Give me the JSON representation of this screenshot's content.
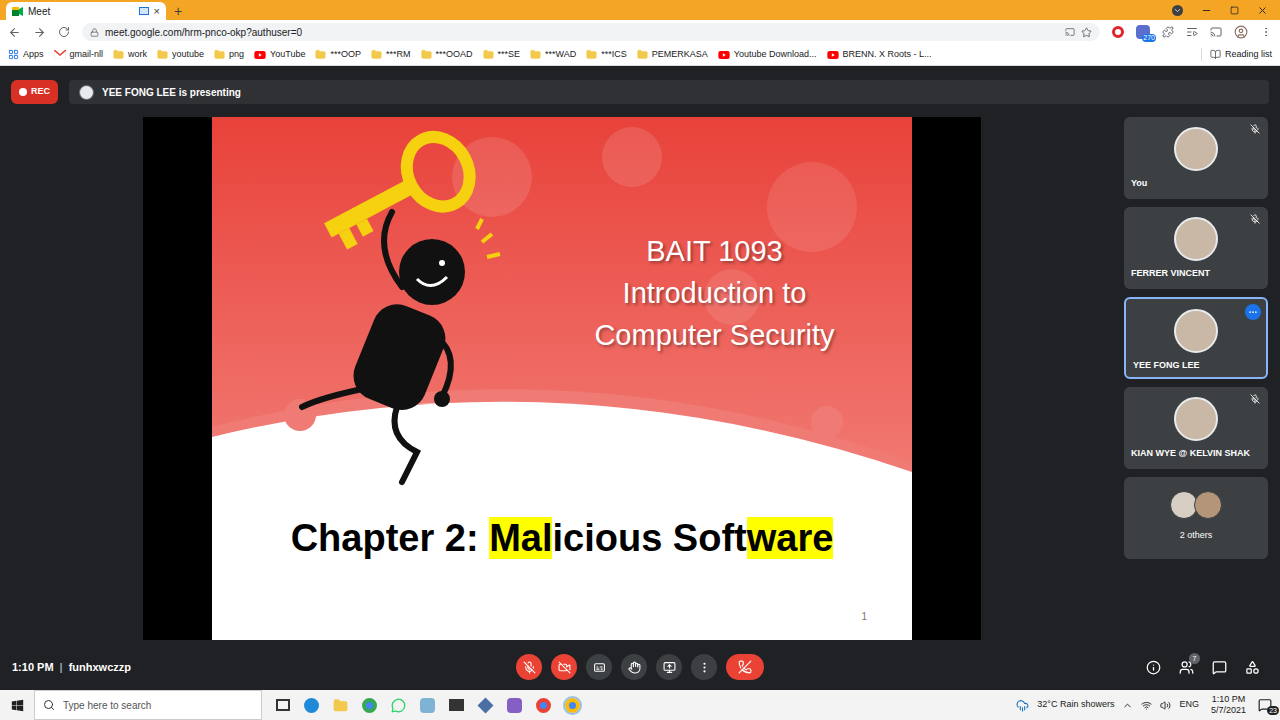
{
  "browser": {
    "tab": {
      "title": "Meet",
      "close": "×"
    },
    "new_tab": "+",
    "url": "meet.google.com/hrm-pnco-okp?authuser=0",
    "extension_badge": "270",
    "bookmarks": [
      {
        "label": "Apps",
        "kind": "apps"
      },
      {
        "label": "gmail-nll",
        "kind": "gmail"
      },
      {
        "label": "work",
        "kind": "folder"
      },
      {
        "label": "youtube",
        "kind": "folder"
      },
      {
        "label": "png",
        "kind": "folder"
      },
      {
        "label": "YouTube",
        "kind": "youtube"
      },
      {
        "label": "***OOP",
        "kind": "folder"
      },
      {
        "label": "***RM",
        "kind": "folder"
      },
      {
        "label": "***OOAD",
        "kind": "folder"
      },
      {
        "label": "***SE",
        "kind": "folder"
      },
      {
        "label": "***WAD",
        "kind": "folder"
      },
      {
        "label": "***ICS",
        "kind": "folder"
      },
      {
        "label": "PEMERKASA",
        "kind": "folder"
      },
      {
        "label": "Youtube Download...",
        "kind": "youtube"
      },
      {
        "label": "BRENN. X Roots - L...",
        "kind": "youtube"
      }
    ],
    "reading_list": "Reading list"
  },
  "meeting": {
    "rec": "REC",
    "presenter": "YEE FONG LEE is presenting",
    "slide": {
      "course": "BAIT 1093",
      "title_lines": [
        "Introduction to",
        "Computer Security"
      ],
      "chapter": [
        {
          "text": "Chapter 2: ",
          "highlighted": false
        },
        {
          "text": "Mal",
          "highlighted": true
        },
        {
          "text": "icious Soft",
          "highlighted": false
        },
        {
          "text": "ware",
          "highlighted": true
        }
      ],
      "page": "1"
    },
    "participants": [
      {
        "name": "You",
        "muted": true,
        "selected": false
      },
      {
        "name": "FERRER VINCENT",
        "muted": true,
        "selected": false
      },
      {
        "name": "YEE FONG LEE",
        "muted": false,
        "selected": true
      },
      {
        "name": "KIAN WYE @ KELVIN SHAK",
        "muted": true,
        "selected": false
      }
    ],
    "others": {
      "label": "2 others"
    },
    "time": "1:10 PM",
    "separator": "|",
    "code": "funhxwczzp",
    "controls": {
      "mic_on": false,
      "camera_on": false
    },
    "people_count": "7"
  },
  "taskbar": {
    "search_placeholder": "Type here to search",
    "weather": "32°C Rain showers",
    "language": "ENG",
    "time": "1:10 PM",
    "date": "5/7/2021",
    "notifications": "23"
  }
}
